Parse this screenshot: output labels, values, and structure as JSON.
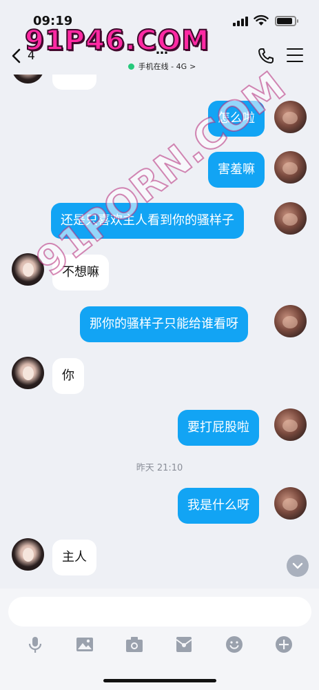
{
  "status_bar": {
    "time": "09:19"
  },
  "nav": {
    "back_count": "4",
    "title": "…",
    "status": "手机在线 - 4G",
    "status_chevron": ">"
  },
  "messages": [
    {
      "side": "out",
      "text": "怎么啦"
    },
    {
      "side": "out",
      "text": "害羞嘛"
    },
    {
      "side": "out",
      "text": "还是只喜欢主人看到你的骚样子"
    },
    {
      "side": "in",
      "text": "不想嘛"
    },
    {
      "side": "out",
      "text": "那你的骚样子只能给谁看呀"
    },
    {
      "side": "in",
      "text": "你"
    },
    {
      "side": "out",
      "text": "要打屁股啦"
    },
    {
      "side": "out",
      "text": "我是什么呀"
    },
    {
      "side": "in",
      "text": "主人"
    }
  ],
  "timestamp": "昨天 21:10",
  "input": {
    "placeholder": ""
  },
  "toolbar": [
    "mic-icon",
    "image-icon",
    "camera-icon",
    "red-packet-icon",
    "emoji-icon",
    "plus-icon"
  ],
  "watermark": {
    "top": "91P46.COM",
    "diagonal": "91PORN.COM"
  },
  "colors": {
    "outgoing_bubble": "#12a4f4",
    "incoming_bubble": "#ffffff",
    "background": "#eef0f5",
    "online": "#27c97c"
  }
}
